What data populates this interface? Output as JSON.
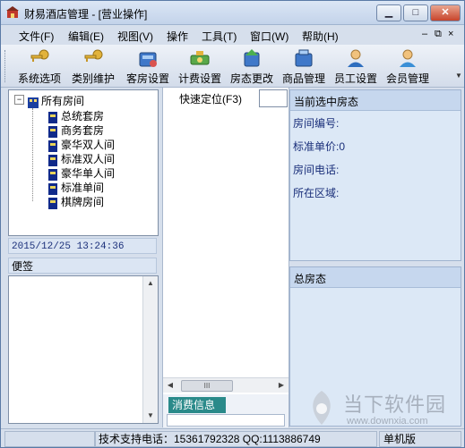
{
  "window": {
    "title": "财易酒店管理 - [营业操作]",
    "controls": {
      "minimize": "▁",
      "maximize": "□",
      "close": "✕"
    }
  },
  "menubar": {
    "items": [
      "文件(F)",
      "编辑(E)",
      "视图(V)",
      "操作",
      "工具(T)",
      "窗口(W)",
      "帮助(H)"
    ],
    "mdi_controls": [
      "–",
      "⧉",
      "×"
    ]
  },
  "toolbar": {
    "buttons": [
      {
        "label": "系统选项",
        "icon": "key-icon"
      },
      {
        "label": "类别维护",
        "icon": "key-icon"
      },
      {
        "label": "客房设置",
        "icon": "room-settings-icon"
      },
      {
        "label": "计费设置",
        "icon": "billing-settings-icon"
      },
      {
        "label": "房态更改",
        "icon": "room-status-icon"
      },
      {
        "label": "商品管理",
        "icon": "goods-icon"
      },
      {
        "label": "员工设置",
        "icon": "staff-icon"
      },
      {
        "label": "会员管理",
        "icon": "member-icon"
      }
    ]
  },
  "tree": {
    "root": "所有房间",
    "expander": "−",
    "children": [
      "总统套房",
      "商务套房",
      "豪华双人间",
      "标准双人间",
      "豪华单人间",
      "标准单间",
      "棋牌房间"
    ]
  },
  "datetime": "2015/12/25 13:24:36",
  "memo": {
    "title": "便签"
  },
  "quick_locate": {
    "label": "快速定位(F3)",
    "value": ""
  },
  "middle": {
    "hscroll_thumb": "III",
    "tab": "消费信息"
  },
  "right": {
    "selected_header": "当前选中房态",
    "fields": [
      "房间编号:",
      "标准单价:0",
      "房间电话:",
      "所在区域:"
    ],
    "total_header": "总房态"
  },
  "status": {
    "support": "技术支持电话：15361792328 QQ:1113886749",
    "edition": "单机版"
  },
  "watermark": {
    "main": "当下软件园",
    "url": "www.downxia.com"
  },
  "colors": {
    "accent": "#c6d7ee",
    "tab": "#2a8a8a",
    "title_close": "#c8442b"
  }
}
